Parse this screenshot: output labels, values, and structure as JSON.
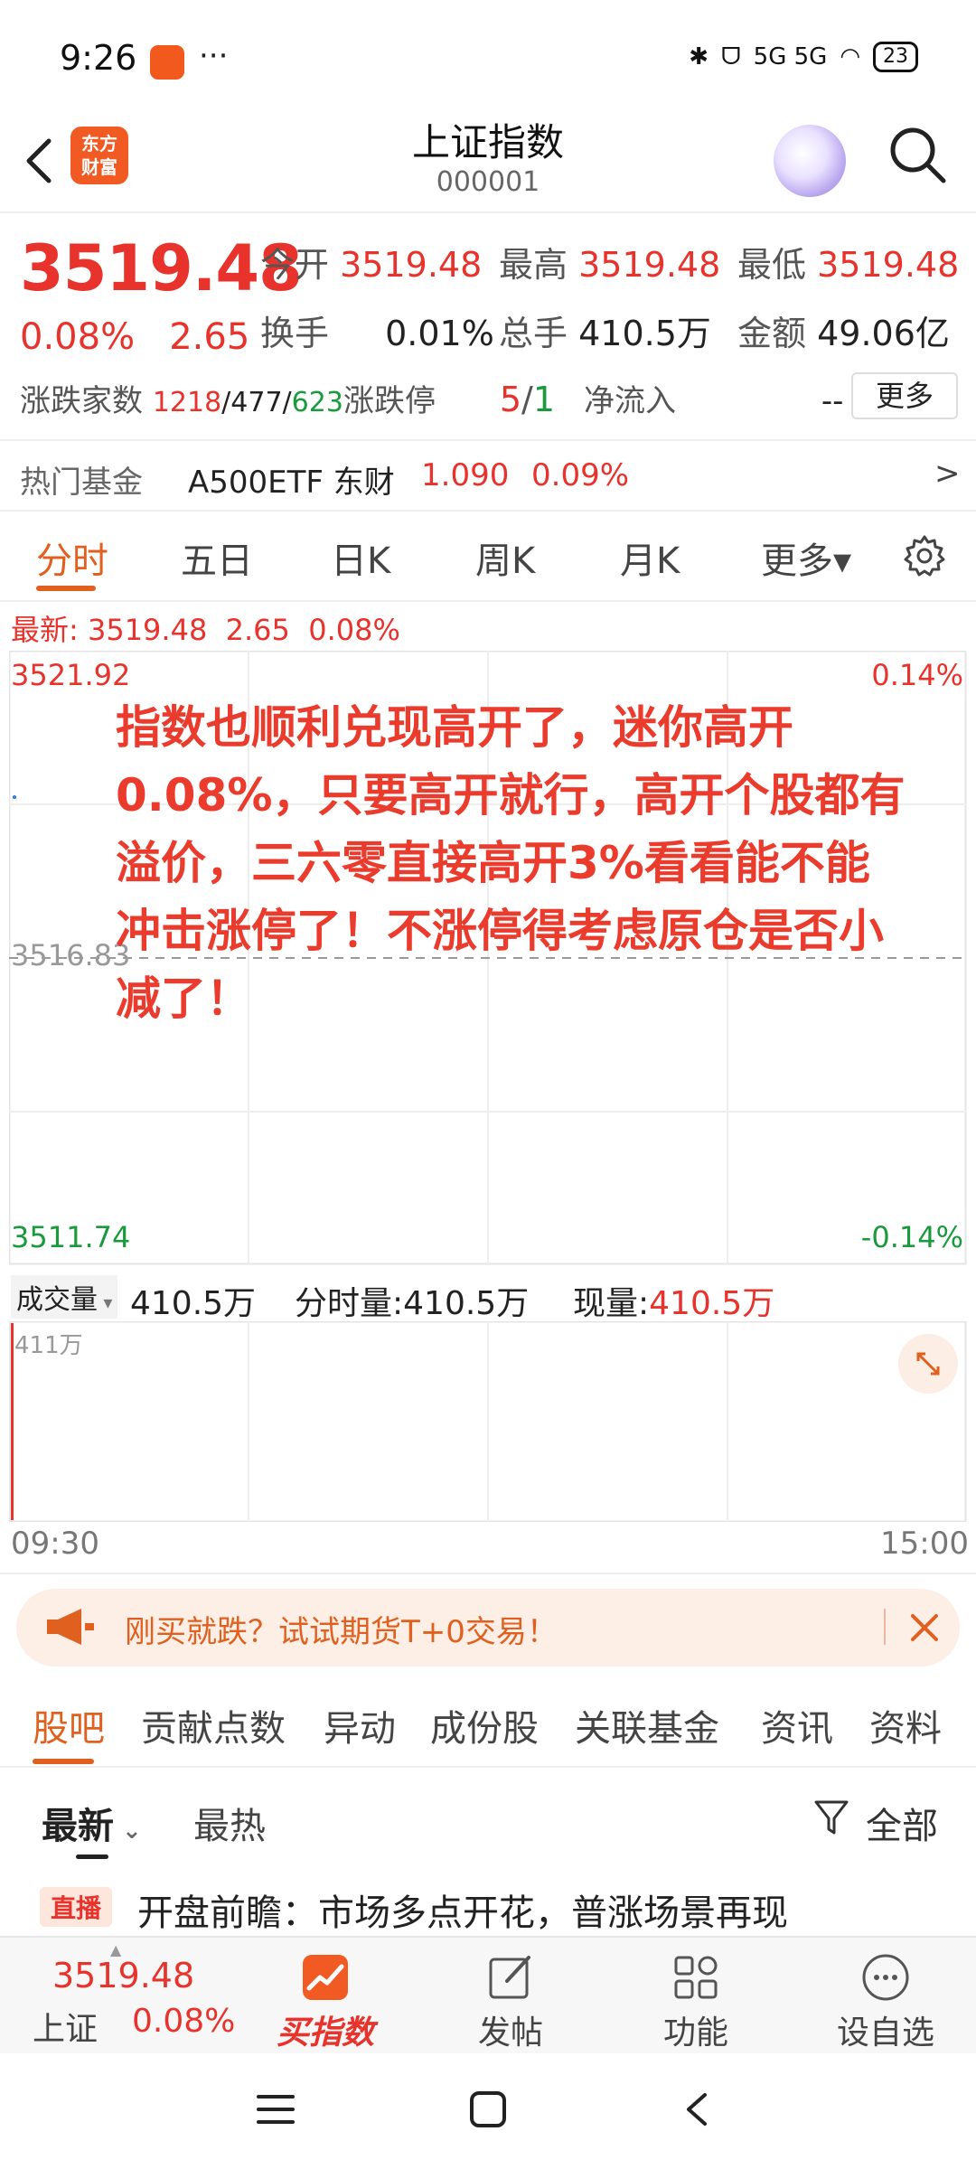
{
  "status_bar": {
    "time": "9:26",
    "more": "···",
    "network": "5G 5G",
    "battery": "23"
  },
  "header": {
    "title": "上证指数",
    "code": "000001",
    "logo_text_top": "东方",
    "logo_text_bottom": "财富"
  },
  "quote": {
    "price": "3519.48",
    "change_pct": "0.08%",
    "change": "2.65",
    "open_label": "今开",
    "open": "3519.48",
    "high_label": "最高",
    "high": "3519.48",
    "low_label": "最低",
    "low": "3519.48",
    "turnover_label": "换手",
    "turnover": "0.01%",
    "volume_label": "总手",
    "volume": "410.5万",
    "amount_label": "金额",
    "amount": "49.06亿",
    "breadth_label": "涨跌家数",
    "breadth_up": "1218",
    "breadth_flat": "/477/",
    "breadth_down": "623",
    "limit_label": "涨跌停",
    "limit_up": "5",
    "limit_sep": "/",
    "limit_down": "1",
    "inflow_label": "净流入",
    "inflow": "--",
    "more_button": "更多"
  },
  "hot_fund": {
    "label": "热门基金",
    "name": "A500ETF 东财",
    "price": "1.090",
    "pct": "0.09%",
    "arrow": ">"
  },
  "chart_tabs": [
    "分时",
    "五日",
    "日K",
    "周K",
    "月K",
    "更多▾"
  ],
  "latest": {
    "label": "最新:",
    "price": "3519.48",
    "change": "2.65",
    "pct": "0.08%"
  },
  "chart": {
    "y_top": "3521.92",
    "y_mid": "3516.83",
    "y_bottom": "3511.74",
    "pct_top": "0.14%",
    "pct_bottom": "-0.14%",
    "annotation": "指数也顺利兑现高开了，迷你高开0.08%，只要高开就行，高开个股都有溢价，三六零直接高开3%看看能不能冲击涨停了！不涨停得考虑原仓是否小减了！",
    "colors": {
      "up": "#e8322c",
      "down": "#1a9a3c",
      "accent": "#e0601f"
    }
  },
  "volume_bar": {
    "selector": "成交量",
    "value": "410.5万",
    "minute_label": "分时量:",
    "minute_value": "410.5万",
    "current_label": "现量:",
    "current_value": "410.5万",
    "scale": "411万"
  },
  "time_axis": {
    "start": "09:30",
    "end": "15:00"
  },
  "banner": {
    "text": "刚买就跌？试试期货T+0交易！"
  },
  "sub_tabs": [
    "股吧",
    "贡献点数",
    "异动",
    "成份股",
    "关联基金",
    "资讯",
    "资料"
  ],
  "sort": {
    "latest": "最新",
    "hot": "最热",
    "filter": "全部"
  },
  "post": {
    "badge": "直播",
    "title": "开盘前瞻：市场多点开花，普涨场景再现"
  },
  "bottom_bar": {
    "index_price": "3519.48",
    "index_name": "上证",
    "index_pct": "0.08%",
    "buy_label": "买指数",
    "post_label": "发帖",
    "func_label": "功能",
    "watch_label": "设自选"
  }
}
